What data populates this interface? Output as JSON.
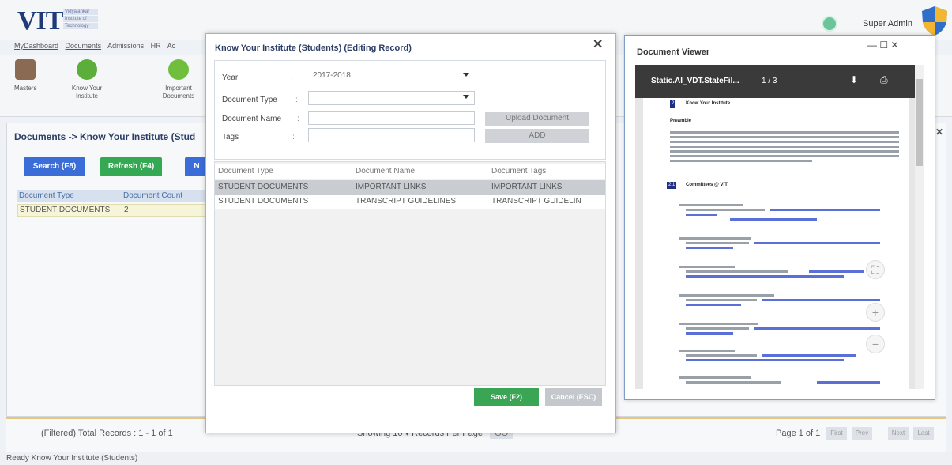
{
  "app": {
    "logo_text": "VIT",
    "logo_sub": [
      "Vidyalankar",
      "Institute of",
      "Technology"
    ],
    "user_name": "Super Admin"
  },
  "menu": [
    "MyDashboard",
    "Documents",
    "Admissions",
    "HR",
    "Ac"
  ],
  "ribbon": {
    "items": [
      {
        "label": "Masters",
        "icon": "masters-icon"
      },
      {
        "label": "Know Your Institute",
        "icon": "know-institute-icon"
      },
      {
        "label": "Important Documents",
        "icon": "important-documents-icon"
      }
    ]
  },
  "main": {
    "breadcrumb": "Documents -> Know Your Institute (Stud",
    "search_label": "Search (F8)",
    "refresh_label": "Refresh (F4)",
    "extra_label": "N",
    "grid": {
      "headers": [
        "Document Type",
        "Document Count"
      ],
      "rows": [
        [
          "STUDENT DOCUMENTS",
          "2"
        ]
      ]
    },
    "total_records": "(Filtered) Total Records : 1 - 1 of 1",
    "paging": "Showing  10  ▾  Records Per Page",
    "go_label": "GO",
    "page_of": "Page 1 of 1",
    "page_buttons": [
      "First",
      "Prev",
      "Next",
      "Last"
    ]
  },
  "status_bar": "Ready  Know Your Institute (Students)",
  "dialog": {
    "title": "Know Your Institute (Students) (Editing Record)",
    "close_symbol": "✕",
    "form": {
      "year_label": "Year",
      "year_value": "2017-2018",
      "doc_type_label": "Document Type",
      "doc_type_value": "",
      "doc_name_label": "Document Name",
      "doc_name_value": "",
      "tags_label": "Tags",
      "tags_value": "",
      "upload_label": "Upload Document",
      "add_label": "ADD"
    },
    "table": {
      "headers": [
        "Document Type",
        "Document Name",
        "Document Tags"
      ],
      "rows": [
        [
          "STUDENT DOCUMENTS",
          "IMPORTANT LINKS",
          "IMPORTANT LINKS"
        ],
        [
          "STUDENT DOCUMENTS",
          "TRANSCRIPT GUIDELINES",
          "TRANSCRIPT GUIDELIN"
        ]
      ]
    },
    "save_label": "Save (F2)",
    "cancel_label": "Cancel (ESC)"
  },
  "viewer": {
    "title": "Document Viewer",
    "controls": "—   ☐   ✕",
    "pdf_name": "Static.AI_VDT.StateFil...",
    "pdf_page": "1 / 3",
    "section1_num": "2",
    "section1_title": "Know Your Institute",
    "preamble": "Preamble",
    "section2_num": "2.1",
    "section2_title": "Committees @ VIT"
  }
}
